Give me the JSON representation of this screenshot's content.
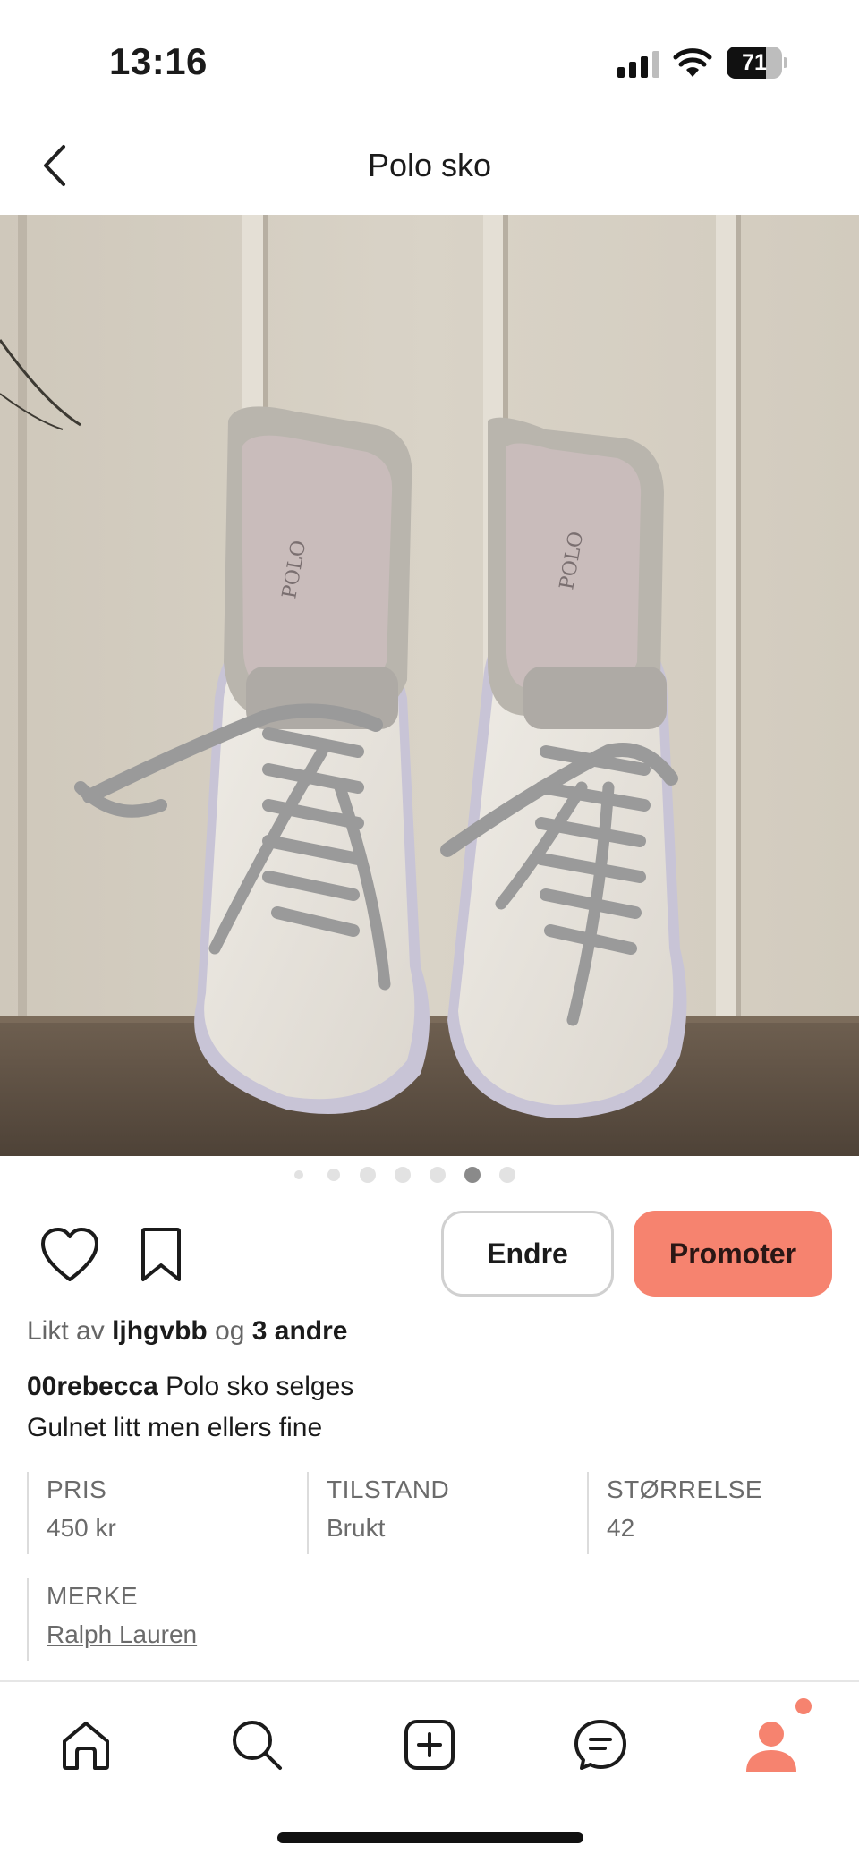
{
  "status_bar": {
    "time": "13:16",
    "battery_level": "71",
    "battery_fraction": 0.71
  },
  "header": {
    "title": "Polo sko"
  },
  "photo": {
    "description_icon": "sneakers-photo"
  },
  "pager": {
    "total": 7,
    "active_index": 5
  },
  "actions": {
    "edit_label": "Endre",
    "promote_label": "Promoter",
    "accent_color": "#f6836f"
  },
  "likes": {
    "prefix": "Likt av",
    "user": "ljhgvbb",
    "joiner": "og",
    "others": "3 andre"
  },
  "caption": {
    "username": "00rebecca",
    "line1": "Polo sko selges",
    "line2": "Gulnet litt men ellers fine"
  },
  "details": [
    {
      "key": "PRIS",
      "value": "450 kr"
    },
    {
      "key": "TILSTAND",
      "value": "Brukt"
    },
    {
      "key": "STØRRELSE",
      "value": "42"
    },
    {
      "key": "MERKE",
      "value": "Ralph Lauren"
    }
  ],
  "bottom_nav": {
    "items": [
      "home-icon",
      "search-icon",
      "add-icon",
      "messages-icon",
      "profile-icon"
    ],
    "active": "profile-icon"
  }
}
